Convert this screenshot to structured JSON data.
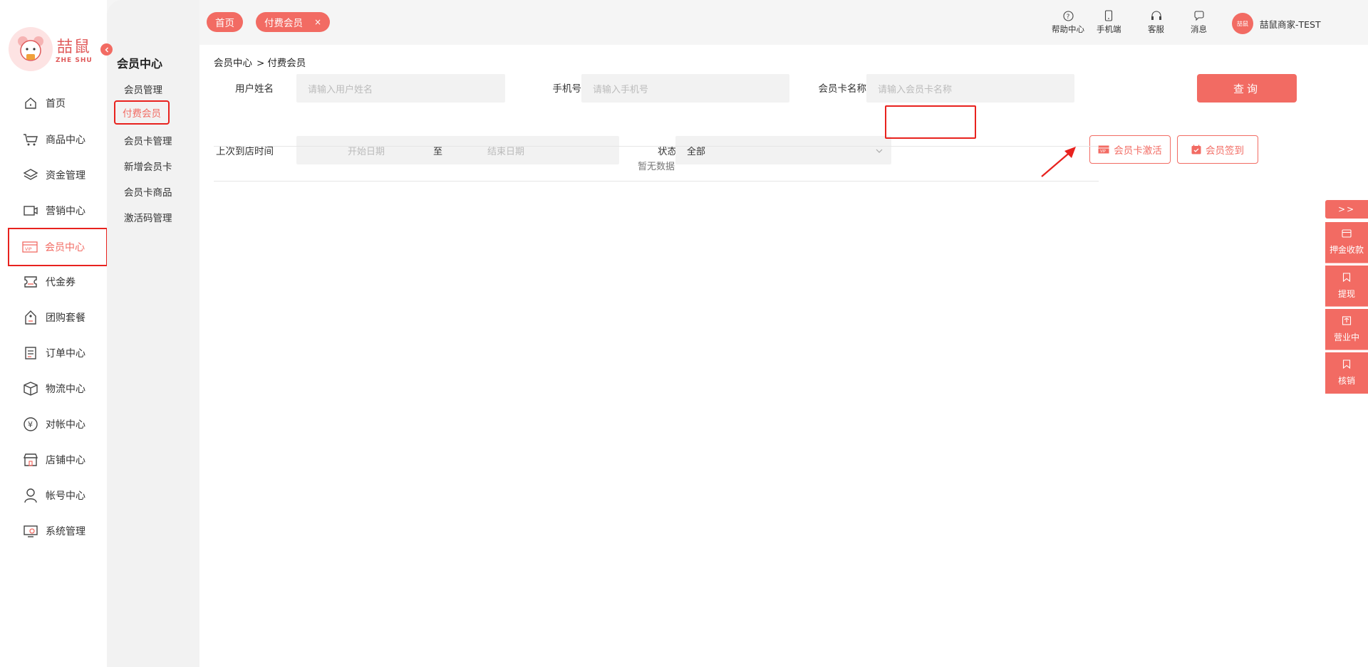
{
  "brand": {
    "name_cn": "喆鼠",
    "name_en": "ZHE SHU"
  },
  "sidebar": {
    "items": [
      {
        "label": "首页",
        "icon": "home-icon"
      },
      {
        "label": "商品中心",
        "icon": "cart-icon"
      },
      {
        "label": "资金管理",
        "icon": "layers-icon"
      },
      {
        "label": "营销中心",
        "icon": "megaphone-icon"
      },
      {
        "label": "会员中心",
        "icon": "vip-card-icon",
        "active": true
      },
      {
        "label": "代金券",
        "icon": "ticket-icon"
      },
      {
        "label": "团购套餐",
        "icon": "tag-icon"
      },
      {
        "label": "订单中心",
        "icon": "document-icon"
      },
      {
        "label": "物流中心",
        "icon": "box-icon"
      },
      {
        "label": "对帐中心",
        "icon": "yen-coin-icon"
      },
      {
        "label": "店铺中心",
        "icon": "store-icon"
      },
      {
        "label": "帐号中心",
        "icon": "user-icon"
      },
      {
        "label": "系统管理",
        "icon": "settings-screen-icon"
      }
    ]
  },
  "subnav": {
    "title": "会员中心",
    "items": [
      {
        "label": "会员管理"
      },
      {
        "label": "付费会员",
        "active": true
      },
      {
        "label": "会员卡管理"
      },
      {
        "label": "新增会员卡"
      },
      {
        "label": "会员卡商品"
      },
      {
        "label": "激活码管理"
      }
    ]
  },
  "topbar": {
    "tabs": [
      {
        "label": "首页"
      },
      {
        "label": "付费会员",
        "closable": true,
        "close": "×"
      }
    ],
    "tools": [
      {
        "label": "帮助中心",
        "icon": "help-circle-icon"
      },
      {
        "label": "手机端",
        "icon": "mobile-icon"
      },
      {
        "label": "客服",
        "icon": "headset-icon"
      },
      {
        "label": "消息",
        "icon": "message-icon"
      }
    ],
    "avatar_text": "喆鼠",
    "user_name": "喆鼠商家-TEST"
  },
  "breadcrumb": {
    "parent": "会员中心",
    "sep": ">",
    "current": "付费会员"
  },
  "filters": {
    "user_name_label": "用户姓名",
    "user_name_placeholder": "请输入用户姓名",
    "phone_label": "手机号",
    "phone_placeholder": "请输入手机号",
    "card_name_label": "会员卡名称",
    "card_name_placeholder": "请输入会员卡名称",
    "last_visit_label": "上次到店时间",
    "start_placeholder": "开始日期",
    "range_sep": "至",
    "end_placeholder": "结束日期",
    "status_label": "状态",
    "status_value": "全部"
  },
  "actions": {
    "query": "查询",
    "activate_card": "会员卡激活",
    "sign_in": "会员签到"
  },
  "table": {
    "empty_text": "暂无数据"
  },
  "float_panel": {
    "expand": ">>",
    "items": [
      {
        "label": "押金收款",
        "icon": "card-icon"
      },
      {
        "label": "提现",
        "icon": "bookmark-icon"
      },
      {
        "label": "营业中",
        "icon": "shop-icon"
      },
      {
        "label": "核销",
        "icon": "bookmark-icon"
      }
    ]
  },
  "colors": {
    "accent": "#f26b63",
    "highlight": "#e8221e"
  }
}
